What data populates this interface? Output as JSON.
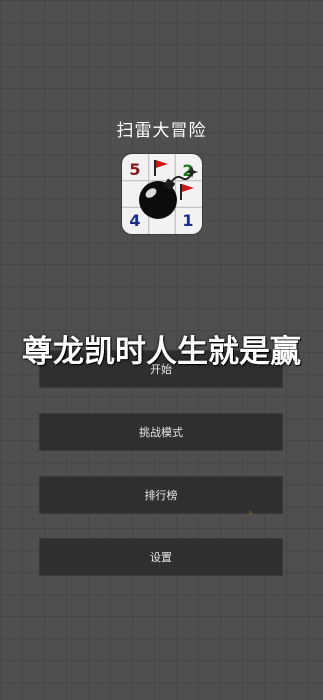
{
  "app": {
    "title": "扫雷大冒险"
  },
  "icon": {
    "name": "minesweeper-bomb-icon",
    "numbers": [
      "5",
      "2",
      "4",
      "1"
    ],
    "colors": {
      "five": "#8a1a1a",
      "two": "#1c7a1c",
      "four": "#1a2f8a",
      "one": "#1a2f8a",
      "flag": "#d01818"
    }
  },
  "overlay": {
    "banner": "尊龙凯时人生就是赢"
  },
  "menu": {
    "start_label": "开始",
    "challenge_label": "挑战模式",
    "leaderboard_label": "排行榜",
    "settings_label": "设置"
  }
}
